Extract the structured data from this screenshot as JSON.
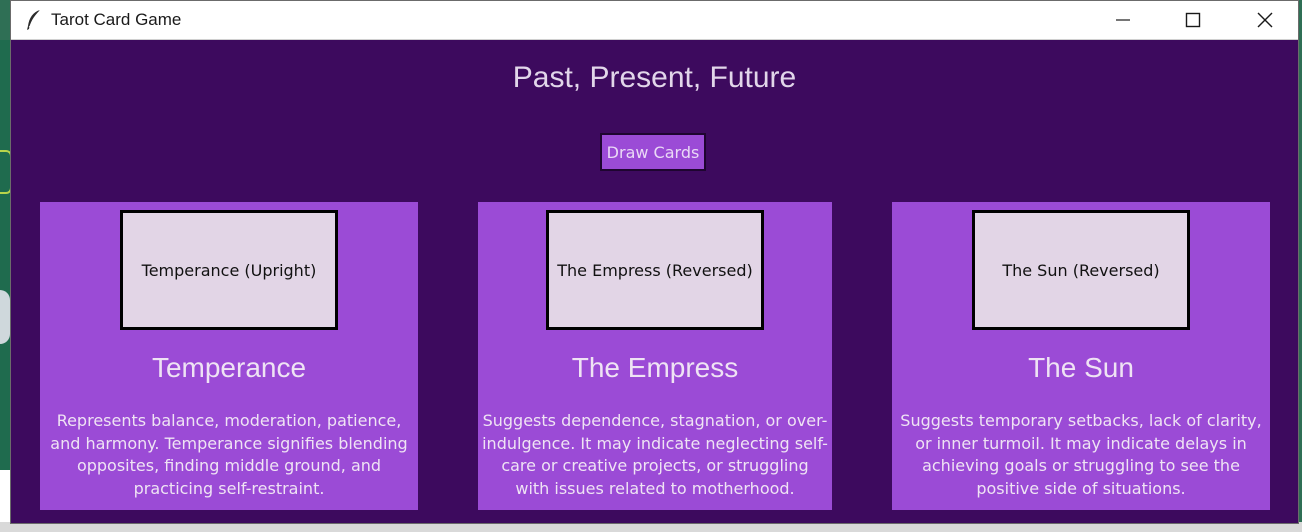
{
  "window": {
    "title": "Tarot Card Game",
    "icon": "feather-icon",
    "controls": [
      "minimize-icon",
      "maximize-icon",
      "close-icon"
    ]
  },
  "spread": {
    "title": "Past, Present, Future",
    "draw_label": "Draw Cards"
  },
  "cards": [
    {
      "label": "Temperance (Upright)",
      "name": "Temperance",
      "description": "Represents balance, moderation, patience, and harmony. Temperance signifies blending opposites, finding middle ground, and practicing self-restraint."
    },
    {
      "label": "The Empress (Reversed)",
      "name": "The Empress",
      "description": "Suggests dependence, stagnation, or over-indulgence. It may indicate neglecting self-care or creative projects, or struggling with issues related to motherhood."
    },
    {
      "label": "The Sun (Reversed)",
      "name": "The Sun",
      "description": "Suggests temporary setbacks, lack of clarity, or inner turmoil. It may indicate delays in achieving goals or struggling to see the positive side of situations."
    }
  ],
  "colors": {
    "background": "#3d0a5e",
    "panel": "#9b4bd6",
    "card_face": "#e2d5e6",
    "text_light": "#efe3f4"
  }
}
